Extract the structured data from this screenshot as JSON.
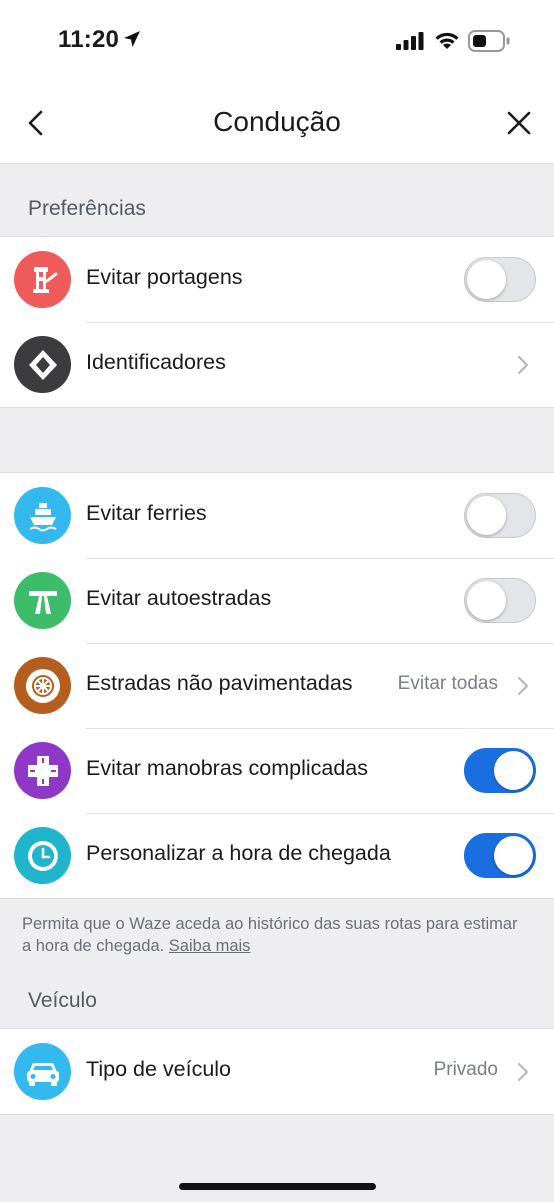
{
  "status_bar": {
    "time": "11:20"
  },
  "nav": {
    "title": "Condução"
  },
  "sections": {
    "preferences": "Preferências",
    "vehicle": "Veículo"
  },
  "preferences_items": [
    {
      "label": "Evitar portagens",
      "toggle": false,
      "color": "#ef5b5b",
      "icon": "toll-booth-icon"
    },
    {
      "label": "Identificadores",
      "color": "#3c3c3e",
      "icon": "diamond-sign-icon"
    }
  ],
  "route_items": [
    {
      "label": "Evitar ferries",
      "toggle": false,
      "color": "#33b9ee",
      "icon": "ferry-icon"
    },
    {
      "label": "Evitar autoestradas",
      "toggle": false,
      "color": "#3dbd6a",
      "icon": "highway-icon"
    },
    {
      "label": "Estradas não pavimentadas",
      "value": "Evitar todas",
      "color": "#b65e1e",
      "icon": "wheel-icon"
    },
    {
      "label": "Evitar manobras complicadas",
      "toggle": true,
      "color": "#8f37c7",
      "icon": "intersection-icon"
    },
    {
      "label": "Personalizar a hora de chegada",
      "toggle": true,
      "color": "#1fb5cc",
      "icon": "clock-icon"
    }
  ],
  "footnote": {
    "text": "Permita que o Waze aceda ao histórico das suas rotas para estimar a hora de chegada.",
    "link": "Saiba mais"
  },
  "vehicle_items": [
    {
      "label": "Tipo de veículo",
      "value": "Privado",
      "color": "#33b9ee",
      "icon": "car-icon"
    }
  ],
  "colors": {
    "accent": "#1a6fe0",
    "background": "#eeeef0"
  }
}
